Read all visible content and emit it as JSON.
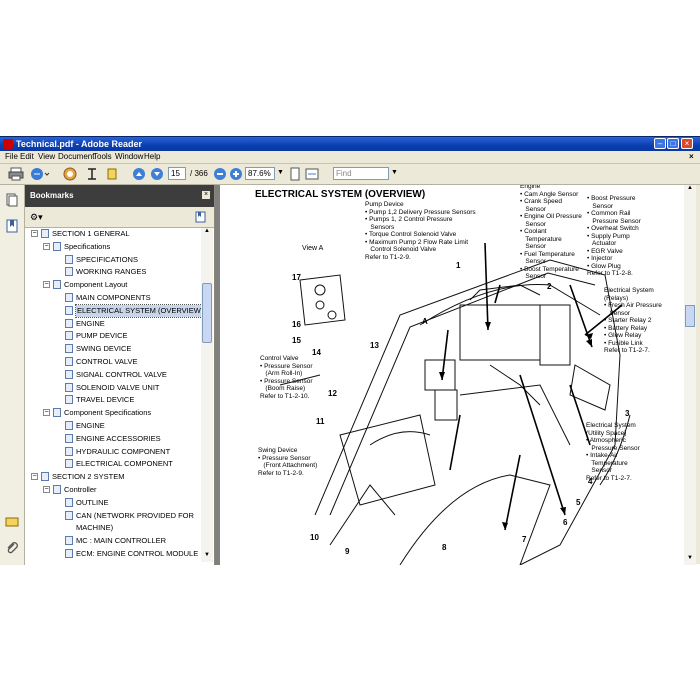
{
  "window": {
    "title": "Technical.pdf - Adobe Reader"
  },
  "menu": [
    "File",
    "Edit",
    "View",
    "Document",
    "Tools",
    "Window",
    "Help"
  ],
  "toolbar": {
    "page_current": "15",
    "page_total": "/ 366",
    "zoom": "87.6%",
    "find_placeholder": "Find"
  },
  "bookmarks": {
    "title": "Bookmarks",
    "items": [
      {
        "label": "SECTION 1 GENERAL",
        "level": 0,
        "expander": "−"
      },
      {
        "label": "Specifications",
        "level": 1,
        "expander": "−"
      },
      {
        "label": "SPECIFICATIONS",
        "level": 2,
        "expander": ""
      },
      {
        "label": "WORKING RANGES",
        "level": 2,
        "expander": ""
      },
      {
        "label": "Component Layout",
        "level": 1,
        "expander": "−"
      },
      {
        "label": "MAIN COMPONENTS",
        "level": 2,
        "expander": ""
      },
      {
        "label": "ELECTRICAL SYSTEM (OVERVIEW)",
        "level": 2,
        "expander": "",
        "selected": true
      },
      {
        "label": "ENGINE",
        "level": 2,
        "expander": ""
      },
      {
        "label": "PUMP DEVICE",
        "level": 2,
        "expander": ""
      },
      {
        "label": "SWING DEVICE",
        "level": 2,
        "expander": ""
      },
      {
        "label": "CONTROL VALVE",
        "level": 2,
        "expander": ""
      },
      {
        "label": "SIGNAL CONTROL VALVE",
        "level": 2,
        "expander": ""
      },
      {
        "label": "SOLENOID VALVE UNIT",
        "level": 2,
        "expander": ""
      },
      {
        "label": "TRAVEL DEVICE",
        "level": 2,
        "expander": ""
      },
      {
        "label": "Component Specifications",
        "level": 1,
        "expander": "−"
      },
      {
        "label": "ENGINE",
        "level": 2,
        "expander": ""
      },
      {
        "label": "ENGINE ACCESSORIES",
        "level": 2,
        "expander": ""
      },
      {
        "label": "HYDRAULIC COMPONENT",
        "level": 2,
        "expander": ""
      },
      {
        "label": "ELECTRICAL COMPONENT",
        "level": 2,
        "expander": ""
      },
      {
        "label": "SECTION 2 SYSTEM",
        "level": 0,
        "expander": "−"
      },
      {
        "label": "Controller",
        "level": 1,
        "expander": "−"
      },
      {
        "label": "OUTLINE",
        "level": 2,
        "expander": ""
      },
      {
        "label": "CAN (NETWORK PROVIDED FOR",
        "level": 2,
        "expander": ""
      },
      {
        "label": "MACHINE)",
        "level": 2,
        "expander": "",
        "cont": true
      },
      {
        "label": "MC : MAIN CONTROLLER",
        "level": 2,
        "expander": ""
      },
      {
        "label": "ECM: ENGINE CONTROL MODULE",
        "level": 2,
        "expander": ""
      }
    ]
  },
  "page": {
    "heading": "ELECTRICAL SYSTEM (OVERVIEW)",
    "view_a": "View A",
    "pump_device": "Pump Device\n• Pump 1,2 Delivery Pressure Sensors\n• Pumps 1, 2 Control Pressure\n   Sensors\n• Torque Control Solenoid Valve\n• Maximum Pump 2 Flow Rate Limit\n   Control Solenoid Valve\nRefer to T1-2-9.",
    "engine_col1": "Engine\n• Cam Angle Sensor\n• Crank Speed\n   Sensor\n• Engine Oil Pressure\n   Sensor\n• Coolant\n   Temperature\n   Sensor\n• Fuel Temperature\n   Sensor\n• Boost Temperature\n   Sensor",
    "engine_col2": "• Boost Pressure\n   Sensor\n• Common Rail\n   Pressure Sensor\n• Overheat Switch\n• Supply Pump\n   Actuator\n• EGR Valve\n• Injector\n• Glow Plug\nRefer to T1-2-8.",
    "relays": "Electrical System\n(Relays)\n• Fresh Air Pressure\n   Sensor\n• Starter Relay 2\n• Battery Relay\n• Glow Relay\n• Fusible Link\nRefer to T1-2-7.",
    "control_valve": "Control Valve\n• Pressure Sensor\n   (Arm Roll-In)\n• Pressure Sensor\n   (Boom Raise)\nRefer to T1-2-10.",
    "utility": "Electrical System\n(Utility Space)\n• Atmospheric\n   Pressure Sensor\n• Intake-Air\n   Temperature\n   Sensor\nRefer to T1-2-7.",
    "swing_device": "Swing Device\n• Pressure Sensor\n   (Front Attachment)\nRefer to T1-2-9.",
    "callouts": {
      "n1": "1",
      "n2": "2",
      "n3": "3",
      "n4": "4",
      "n5": "5",
      "n6": "6",
      "n7": "7",
      "n8": "8",
      "n9": "9",
      "n10": "10",
      "n11": "11",
      "n12": "12",
      "n13": "13",
      "n14": "14",
      "n15": "15",
      "n16": "16",
      "n17": "17",
      "a": "A"
    }
  }
}
